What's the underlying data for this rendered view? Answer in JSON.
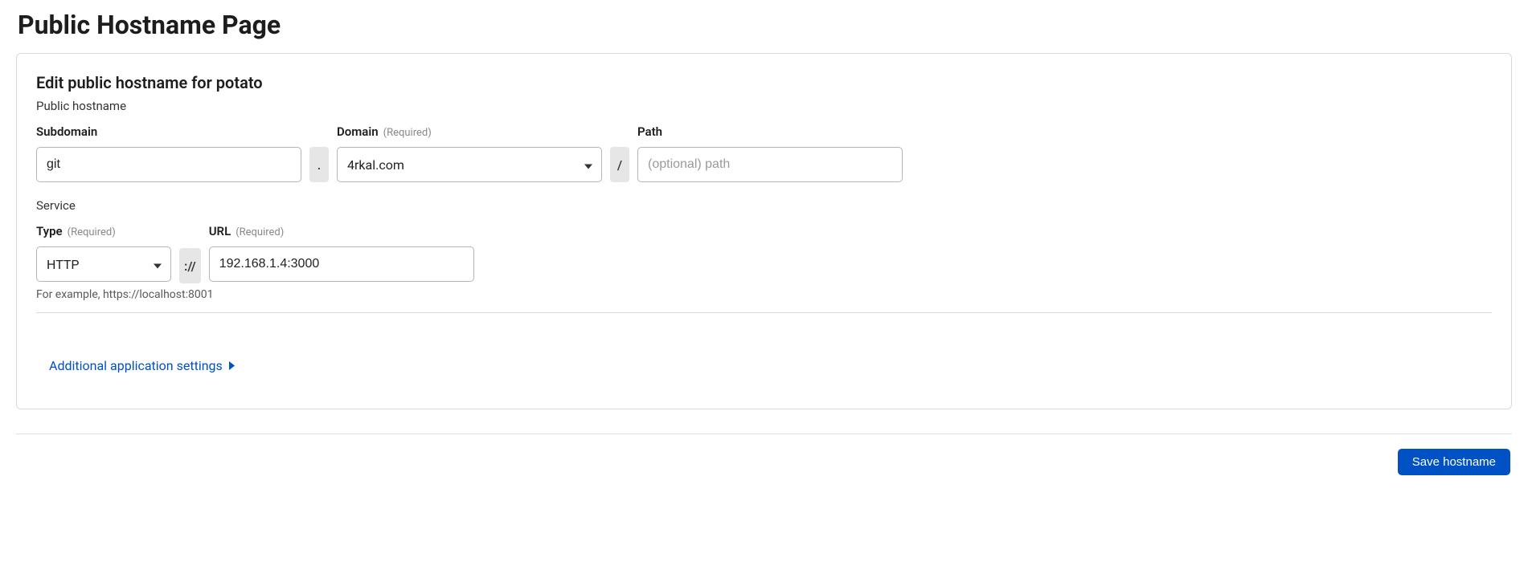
{
  "page": {
    "title": "Public Hostname Page"
  },
  "card": {
    "title": "Edit public hostname for potato",
    "hostnameSection": "Public hostname",
    "serviceSection": "Service"
  },
  "labels": {
    "subdomain": "Subdomain",
    "domain": "Domain",
    "path": "Path",
    "type": "Type",
    "url": "URL",
    "required": "(Required)"
  },
  "values": {
    "subdomain": "git",
    "domain": "4rkal.com",
    "path": "",
    "pathPlaceholder": "(optional) path",
    "type": "HTTP",
    "url": "192.168.1.4:3000"
  },
  "separators": {
    "dot": ".",
    "slash": "/",
    "protocol": "://"
  },
  "hint": "For example, https://localhost:8001",
  "additional": "Additional application settings",
  "actions": {
    "save": "Save hostname"
  }
}
